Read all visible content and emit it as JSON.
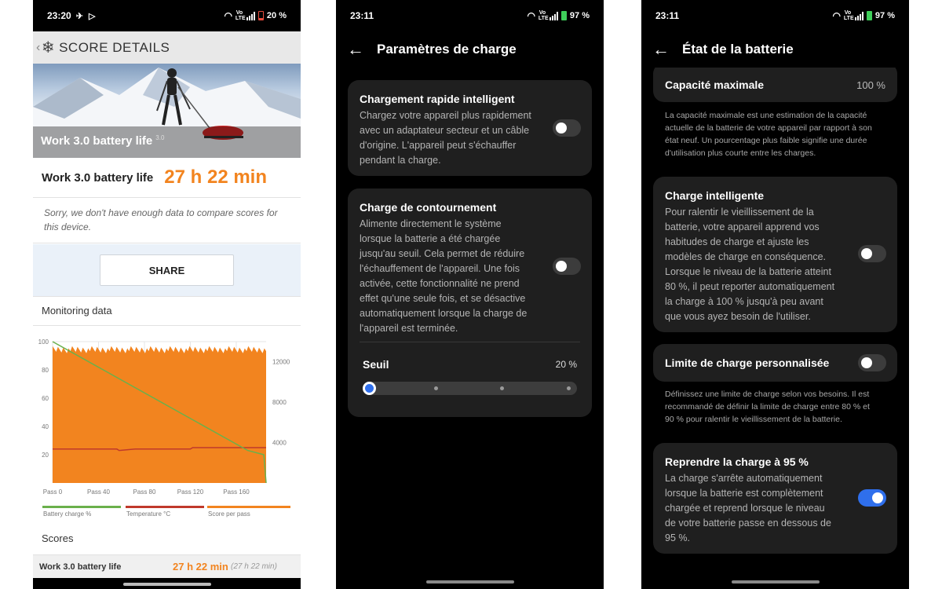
{
  "screen1": {
    "status": {
      "time": "23:20",
      "battery": "20 %"
    },
    "header_title": "SCORE DETAILS",
    "hero_title": "Work 3.0 battery life",
    "hero_version": "3.0",
    "result_label": "Work 3.0 battery life",
    "result_value": "27 h 22 min",
    "sorry_text": "Sorry, we don't have enough data to compare scores for this device.",
    "share_label": "SHARE",
    "monitoring_title": "Monitoring data",
    "scores_title": "Scores",
    "score_row": {
      "label": "Work 3.0 battery life",
      "value": "27 h 22 min",
      "sub": "(27 h 22 min)"
    },
    "chart_data": {
      "type": "line",
      "x_tick_labels": [
        "Pass 0",
        "Pass 40",
        "Pass 80",
        "Pass 120",
        "Pass 160"
      ],
      "y_left_ticks": [
        "100",
        "80",
        "60",
        "40",
        "20"
      ],
      "y_right_ticks": [
        "12000",
        "8000",
        "4000"
      ],
      "ylim_left": [
        0,
        100
      ],
      "ylim_right": [
        0,
        14000
      ],
      "series": [
        {
          "name": "Battery charge %",
          "color": "#6ab04c",
          "x": [
            0,
            170,
            184,
            186
          ],
          "y": [
            100,
            23,
            20,
            0
          ]
        },
        {
          "name": "Temperature °C",
          "color": "#c0392b",
          "x": [
            0,
            56,
            58,
            72,
            120,
            122,
            186
          ],
          "y": [
            24,
            24,
            23,
            24,
            24,
            25,
            25
          ]
        },
        {
          "name": "Score per pass",
          "color": "#f2841f",
          "x": [
            0,
            186
          ],
          "y": [
            13200,
            13200
          ]
        }
      ],
      "legend_position": "bottom"
    }
  },
  "screen2": {
    "status": {
      "time": "23:11",
      "battery": "97 %"
    },
    "title": "Paramètres de charge",
    "card1": {
      "title": "Chargement rapide intelligent",
      "desc": [
        "Chargez votre appareil plus rapidement",
        "avec un adaptateur secteur et un câble",
        "d'origine. L'appareil peut s'échauffer",
        "pendant la charge."
      ]
    },
    "card2": {
      "title": "Charge de contournement",
      "desc": [
        "Alimente directement le système",
        "lorsque la batterie a été chargée",
        "jusqu'au seuil. Cela permet de réduire",
        "l'échauffement de l'appareil. Une fois",
        "activée, cette fonctionnalité ne prend",
        "effet qu'une seule fois, et se désactive",
        "automatiquement lorsque la charge de",
        "l'appareil est terminée."
      ],
      "threshold_label": "Seuil",
      "threshold_value": "20 %",
      "threshold_fraction": 0
    }
  },
  "screen3": {
    "status": {
      "time": "23:11",
      "battery": "97 %"
    },
    "title": "État de la batterie",
    "capacity_label": "Capacité maximale",
    "capacity_value": "100 %",
    "capacity_note": [
      "La capacité maximale est une estimation de la capacité",
      "actuelle de la batterie de votre appareil par rapport à son",
      "état neuf. Un pourcentage plus faible signifie une durée",
      "d'utilisation plus courte entre les charges."
    ],
    "smart": {
      "title": "Charge intelligente",
      "desc": [
        "Pour ralentir le vieillissement de la",
        "batterie, votre appareil apprend vos",
        "habitudes de charge et ajuste les",
        "modèles de charge en conséquence.",
        "Lorsque le niveau de la batterie atteint",
        "80 %, il peut reporter automatiquement",
        "la charge à 100 % jusqu'à peu avant",
        "que vous ayez besoin de l'utiliser."
      ]
    },
    "limit_label": "Limite de charge personnalisée",
    "limit_note": [
      "Définissez une limite de charge selon vos besoins. Il est",
      "recommandé de définir la limite de charge entre 80 % et",
      "90 % pour ralentir le vieillissement de la batterie."
    ],
    "resume": {
      "title": "Reprendre la charge à 95 %",
      "desc": [
        "La charge s'arrête automatiquement",
        "lorsque la batterie est complètement",
        "chargée et reprend lorsque le niveau",
        "de votre batterie passe en dessous de",
        "95 %."
      ]
    }
  },
  "colors": {
    "accent_orange": "#f2841f",
    "toggle_on": "#2f6fec",
    "card_bg": "#1f1f1f"
  }
}
